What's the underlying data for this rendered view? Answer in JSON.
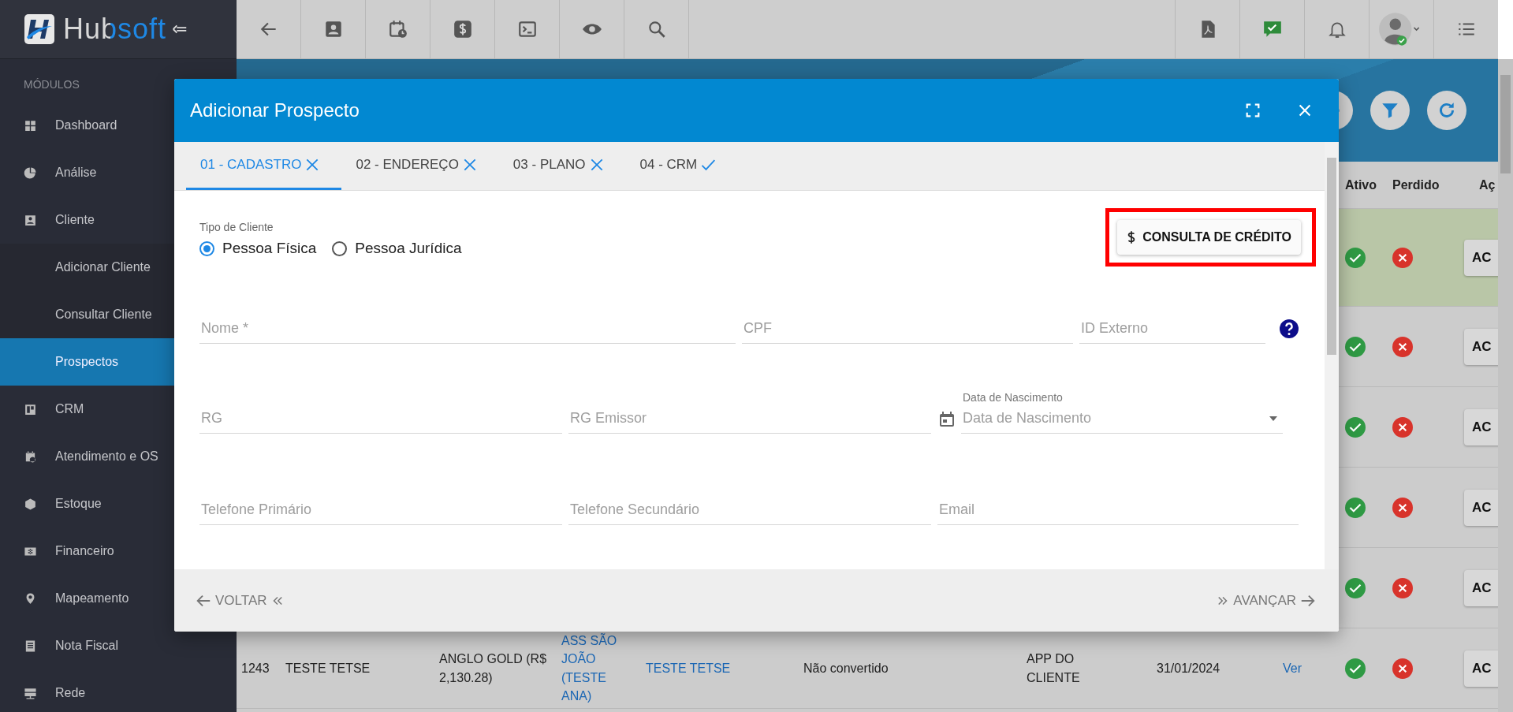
{
  "app": {
    "logo": "Hubsoft"
  },
  "sidebar": {
    "section": "MÓDULOS",
    "items": [
      {
        "label": "Dashboard",
        "kind": "module",
        "selected": false
      },
      {
        "label": "Análise",
        "kind": "module",
        "selected": false
      },
      {
        "label": "Cliente",
        "kind": "module",
        "selected": false
      },
      {
        "label": "Adicionar Cliente",
        "kind": "sub",
        "selected": false
      },
      {
        "label": "Consultar Cliente",
        "kind": "sub",
        "selected": false
      },
      {
        "label": "Prospectos",
        "kind": "sub",
        "selected": true
      },
      {
        "label": "CRM",
        "kind": "module",
        "selected": false
      },
      {
        "label": "Atendimento e OS",
        "kind": "module",
        "selected": false
      },
      {
        "label": "Estoque",
        "kind": "module",
        "selected": false
      },
      {
        "label": "Financeiro",
        "kind": "module",
        "selected": false
      },
      {
        "label": "Mapeamento",
        "kind": "module",
        "selected": false
      },
      {
        "label": "Nota Fiscal",
        "kind": "module",
        "selected": false
      },
      {
        "label": "Rede",
        "kind": "module",
        "selected": false
      }
    ]
  },
  "table": {
    "columns": [
      "Ativo",
      "Perdido",
      "Aç"
    ],
    "rows": [
      {
        "selected": true,
        "action": "AC"
      },
      {
        "selected": false,
        "action": "AC"
      },
      {
        "selected": false,
        "action": "AC"
      },
      {
        "selected": false,
        "action": "AC"
      },
      {
        "selected": false,
        "action": "AC"
      },
      {
        "selected": false,
        "action": "AC",
        "cells": [
          {
            "text": "1243",
            "kind": "text"
          },
          {
            "text": "TESTE TETSE",
            "kind": "text"
          },
          {
            "text": "ANGLO GOLD (R$ 2,130.28)",
            "kind": "text"
          },
          {
            "text": "ASS SÃO JOÃO (TESTE ANA)",
            "kind": "link"
          },
          {
            "text": "TESTE TETSE",
            "kind": "link"
          },
          {
            "text": "Não convertido",
            "kind": "text"
          },
          {
            "text": "APP DO CLIENTE",
            "kind": "text"
          },
          {
            "text": "31/01/2024",
            "kind": "text"
          },
          {
            "text": "Ver",
            "kind": "link"
          }
        ]
      }
    ]
  },
  "modal": {
    "title": "Adicionar Prospecto",
    "tabs": [
      {
        "label": "01 - CADASTRO",
        "selected": true,
        "complete": false
      },
      {
        "label": "02 - ENDEREÇO",
        "selected": false,
        "complete": false
      },
      {
        "label": "03 - PLANO",
        "selected": false,
        "complete": false
      },
      {
        "label": "04 - CRM",
        "selected": false,
        "complete": true
      }
    ],
    "client_type": {
      "label": "Tipo de Cliente",
      "options": [
        {
          "label": "Pessoa Física",
          "selected": true
        },
        {
          "label": "Pessoa Jurídica",
          "selected": false
        }
      ]
    },
    "credit_button": "CONSULTA DE CRÉDITO",
    "field_rows": [
      [
        {
          "placeholder": "Nome *",
          "kind": "text"
        },
        {
          "placeholder": "CPF",
          "kind": "text"
        },
        {
          "placeholder": "ID Externo",
          "kind": "help"
        }
      ],
      [
        {
          "placeholder": "RG",
          "kind": "text"
        },
        {
          "placeholder": "RG Emissor",
          "kind": "text"
        },
        {
          "placeholder": "Data de Nascimento",
          "label": "Data de Nascimento",
          "kind": "date"
        }
      ],
      [
        {
          "placeholder": "Telefone Primário",
          "kind": "text"
        },
        {
          "placeholder": "Telefone Secundário",
          "kind": "text"
        },
        {
          "placeholder": "Email",
          "kind": "text"
        }
      ]
    ],
    "back_button": "VOLTAR",
    "next_button": "AVANÇAR"
  }
}
